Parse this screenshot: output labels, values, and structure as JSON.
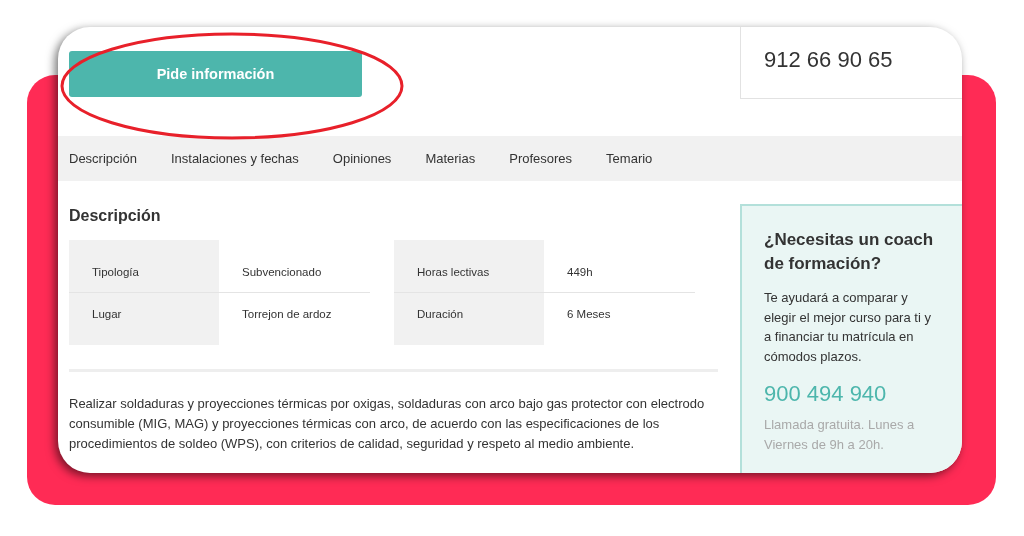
{
  "header": {
    "button": "Pide información",
    "phone": "912 66 90 65"
  },
  "annotation": {
    "kind": "ellipse"
  },
  "tabs": [
    {
      "label": "Descripción"
    },
    {
      "label": "Instalaciones y fechas"
    },
    {
      "label": "Opiniones"
    },
    {
      "label": "Materias"
    },
    {
      "label": "Profesores"
    },
    {
      "label": "Temario"
    }
  ],
  "description": {
    "title": "Descripción",
    "detail_groups": [
      {
        "rows": [
          {
            "label": "Tipología",
            "value": "Subvencionado"
          },
          {
            "label": "Lugar",
            "value": "Torrejon de ardoz"
          }
        ]
      },
      {
        "rows": [
          {
            "label": "Horas lectivas",
            "value": "449h"
          },
          {
            "label": "Duración",
            "value": "6 Meses"
          }
        ]
      }
    ],
    "text": "Realizar soldaduras y proyecciones térmicas por oxigas, soldaduras con arco bajo gas protector con electrodo consumible (MIG, MAG) y proyecciones térmicas con arco, de acuerdo con las especificaciones de los procedimientos de soldeo (WPS), con criterios de calidad, seguridad y respeto al medio ambiente."
  },
  "coach": {
    "title": "¿Necesitas un coach de formación?",
    "text": "Te ayudará a comparar y elegir el mejor curso para ti y a financiar tu matrícula en cómodos plazos.",
    "phone": "900 494 940",
    "note": "Llamada gratuita. Lunes a Viernes de 9h a 20h."
  }
}
